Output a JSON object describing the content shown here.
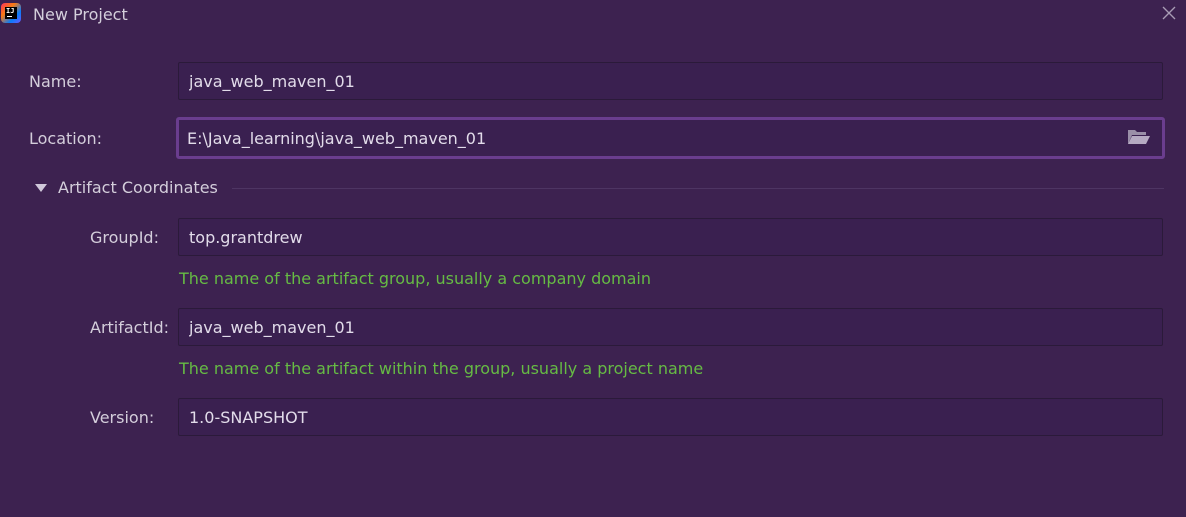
{
  "window": {
    "title": "New Project",
    "app_icon_text": "IJ"
  },
  "form": {
    "name": {
      "label": "Name:",
      "value": "java_web_maven_01"
    },
    "location": {
      "label": "Location:",
      "value": "E:\\Java_learning\\java_web_maven_01"
    },
    "artifact_section": {
      "title": "Artifact Coordinates",
      "expanded": true
    },
    "group_id": {
      "label": "GroupId:",
      "value": "top.grantdrew",
      "hint": "The name of the artifact group, usually a company domain"
    },
    "artifact_id": {
      "label": "ArtifactId:",
      "value": "java_web_maven_01",
      "hint": "The name of the artifact within the group, usually a project name"
    },
    "version": {
      "label": "Version:",
      "value": "1.0-SNAPSHOT"
    }
  },
  "icons": {
    "close": "close-icon",
    "folder": "folder-open-icon",
    "expand": "triangle-down-icon"
  },
  "colors": {
    "background": "#3d2250",
    "field_background": "#3a2050",
    "focus_border": "#6a3d8e",
    "hint_text": "#66bb44",
    "text": "#d4cedb"
  }
}
